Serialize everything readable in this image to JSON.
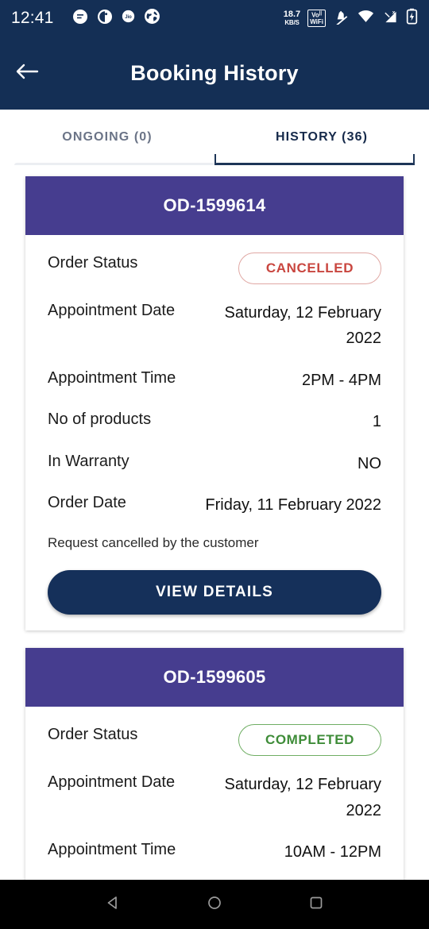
{
  "status_bar": {
    "clock": "12:41",
    "left_icons": [
      "message-icon",
      "app-icon",
      "jio-icon",
      "globe-icon"
    ],
    "network_speed": "18.7",
    "network_speed_unit": "KB/S",
    "volte_wifi": "VoWiFi",
    "right_icons": [
      "mute-icon",
      "wifi-icon",
      "signal-icon",
      "battery-icon"
    ]
  },
  "app_bar": {
    "back_icon": "arrow-left-icon",
    "title": "Booking History"
  },
  "tabs": [
    {
      "label": "ONGOING (0)",
      "active": false
    },
    {
      "label": "HISTORY (36)",
      "active": true
    }
  ],
  "labels": {
    "order_status": "Order Status",
    "appointment_date": "Appointment Date",
    "appointment_time": "Appointment Time",
    "no_of_products": "No of products",
    "in_warranty": "In Warranty",
    "order_date": "Order Date"
  },
  "colors": {
    "header_navy": "#142f55",
    "card_header_purple": "#463d8f",
    "cancelled_red": "#c9463f",
    "completed_green": "#3e8c38",
    "button_navy": "#15305a"
  },
  "orders": [
    {
      "order_id": "OD-1599614",
      "status": "CANCELLED",
      "status_type": "cancelled",
      "appointment_date": "Saturday, 12 February 2022",
      "appointment_time": "2PM - 4PM",
      "no_of_products": "1",
      "in_warranty": "NO",
      "order_date": "Friday, 11 February 2022",
      "note": "Request cancelled by the customer",
      "button_label": "VIEW DETAILS"
    },
    {
      "order_id": "OD-1599605",
      "status": "COMPLETED",
      "status_type": "completed",
      "appointment_date": "Saturday, 12 February 2022",
      "appointment_time": "10AM - 12PM"
    }
  ],
  "nav_bar": {
    "back": "back-triangle-icon",
    "home": "home-circle-icon",
    "recents": "recents-square-icon"
  }
}
